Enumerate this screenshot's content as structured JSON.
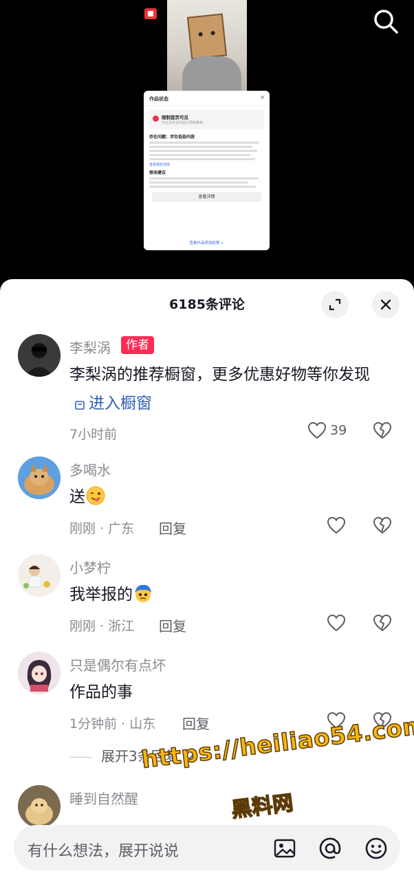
{
  "video": {
    "notice": {
      "title": "作品状态",
      "close": "×",
      "status_title": "限制首页可见",
      "status_sub": "仅主页可见作品已限制推荐",
      "problem_heading": "存在问题：涉及低俗内容",
      "detail_link": "查看规则详情",
      "advice_heading": "修改建议",
      "button": "查看详情",
      "footer": "查看作品修改权限 >"
    }
  },
  "panel": {
    "title": "6185条评论",
    "expand_icon": "expand-icon",
    "close_icon": "close-icon"
  },
  "comments": [
    {
      "name": "李梨涡",
      "tag": "作者",
      "text": "李梨涡的推荐橱窗，更多优惠好物等你发现",
      "link": "进入橱窗",
      "time": "7小时前",
      "likes": "39"
    },
    {
      "name": "多喝水",
      "text": "送",
      "emoji": "wink-tongue-emoji",
      "time": "刚刚 · 广东",
      "reply": "回复"
    },
    {
      "name": "小梦柠",
      "text": "我举报的",
      "emoji": "blue-hair-face-emoji",
      "time": "刚刚 · 浙江",
      "reply": "回复"
    },
    {
      "name": "只是偶尔有点坏",
      "text": "作品的事",
      "time": "1分钟前 · 山东",
      "reply": "回复",
      "expand": "展开3条回复"
    },
    {
      "name": "睡到自然醒"
    }
  ],
  "watermark": {
    "url": "https://heiliao54.com",
    "name": "黑料网"
  },
  "input": {
    "placeholder": "有什么想法，展开说说"
  },
  "colors": {
    "accent": "#fe2c55",
    "link": "#2e5fb5",
    "watermark": "#f8b60f"
  }
}
